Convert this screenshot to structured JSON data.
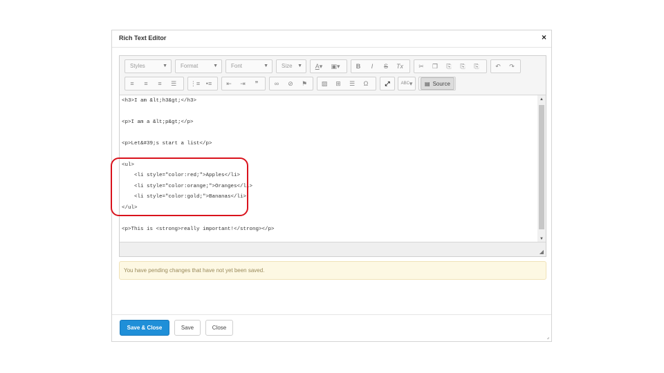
{
  "dialog": {
    "title": "Rich Text Editor",
    "close_glyph": "×"
  },
  "toolbar": {
    "combos": [
      {
        "name": "styles-combo",
        "label": "Styles"
      },
      {
        "name": "format-combo",
        "label": "Format"
      },
      {
        "name": "font-combo",
        "label": "Font"
      },
      {
        "name": "size-combo",
        "label": "Size"
      }
    ],
    "source_label": "Source",
    "icons": {
      "text_color": "A",
      "bold": "B",
      "italic": "I",
      "strike": "S",
      "remove_format": "Tx",
      "omega": "Ω",
      "spell": "ABC"
    }
  },
  "code_lines": [
    "<h3>I am &lt;h3&gt;</h3>",
    "<p>I am a &lt;p&gt;</p>",
    "<p>Let&#39;s start a list</p>",
    "<ul>",
    "    <li style=\"color:red;\">Apples</li>",
    "    <li style=\"color:orange;\">Oranges</li>",
    "    <li style=\"color:gold;\">Bananas</li>",
    "</ul>",
    "<p>This is <strong>really important!</strong></p>"
  ],
  "alert": {
    "message": "You have pending changes that have not yet been saved."
  },
  "footer": {
    "save_close": "Save & Close",
    "save": "Save",
    "close": "Close"
  },
  "colors": {
    "primary": "#1f8fd8",
    "highlight": "#d9121c",
    "alert_bg": "#fdf8e3"
  }
}
